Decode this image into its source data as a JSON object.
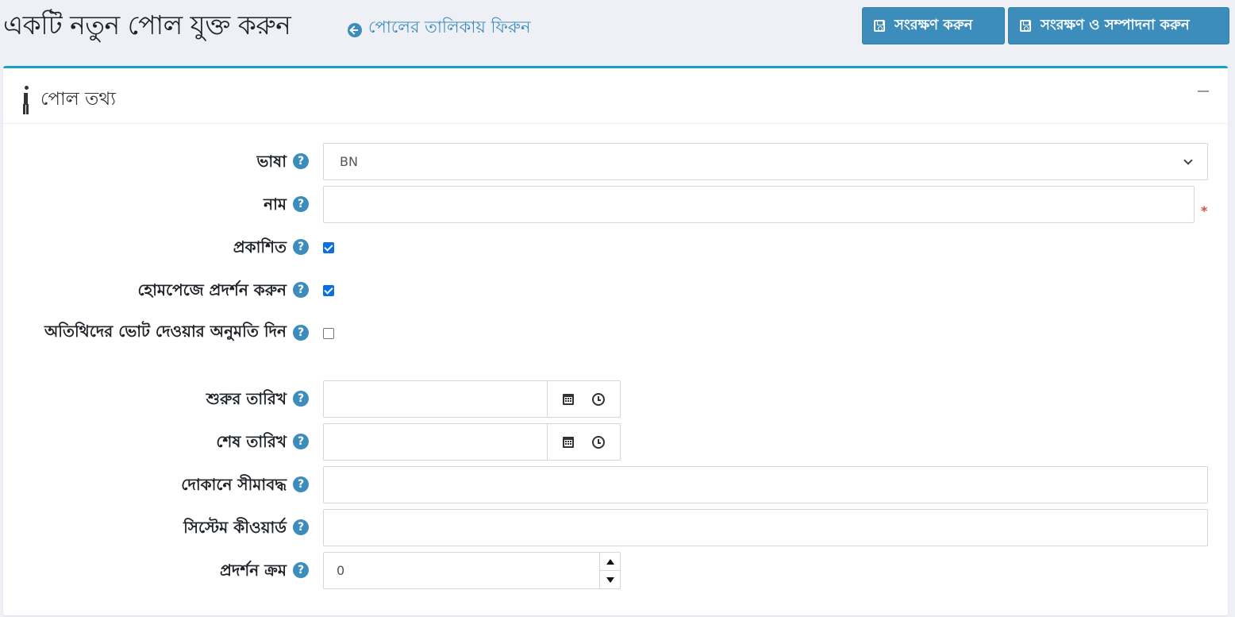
{
  "header": {
    "title": "একটি নতুন পোল যুক্ত করুন",
    "back_link": "পোলের তালিকায় ফিরুন",
    "save_button": "সংরক্ষণ করুন",
    "save_edit_button": "সংরক্ষণ ও সম্পাদনা করুন"
  },
  "card": {
    "title": "পোল তথ্য"
  },
  "form": {
    "language": {
      "label": "ভাষা",
      "value": "BN"
    },
    "name": {
      "label": "নাম",
      "value": "",
      "required_mark": "*"
    },
    "published": {
      "label": "প্রকাশিত",
      "checked": true
    },
    "show_on_homepage": {
      "label": "হোমপেজে প্রদর্শন করুন",
      "checked": true
    },
    "allow_guests": {
      "label": "অতিথিদের ভোট দেওয়ার অনুমতি দিন",
      "checked": false
    },
    "start_date": {
      "label": "শুরুর তারিখ",
      "value": ""
    },
    "end_date": {
      "label": "শেষ তারিখ",
      "value": ""
    },
    "limited_to_stores": {
      "label": "দোকানে সীমাবদ্ধ",
      "value": ""
    },
    "system_keyword": {
      "label": "সিস্টেম কীওয়ার্ড",
      "value": ""
    },
    "display_order": {
      "label": "প্রদর্শন ক্রম",
      "value": "0"
    }
  },
  "help_icon": "?",
  "colors": {
    "primary": "#3c8dbc",
    "card_accent": "#17a2c8",
    "checkbox": "#0b6ee3",
    "required": "#dd4b39",
    "background": "#eef0f5"
  }
}
